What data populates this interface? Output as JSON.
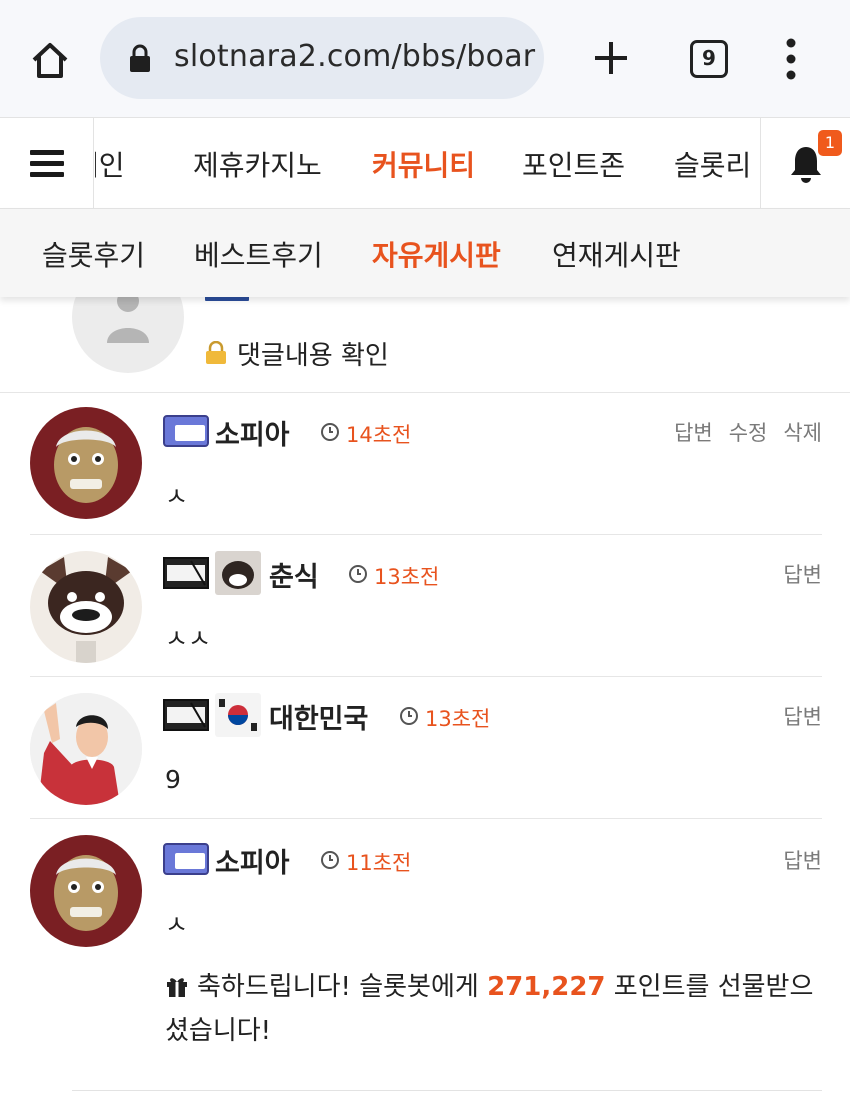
{
  "browser": {
    "url": "slotnara2.com/bbs/boar",
    "tab_count": "9",
    "icons": [
      "home-icon",
      "lock-icon",
      "plus-icon",
      "tabs-icon",
      "more-vert-icon"
    ]
  },
  "nav": {
    "items": [
      "메인",
      "제휴카지노",
      "커뮤니티",
      "포인트존",
      "슬롯리"
    ],
    "active": "커뮤니티",
    "notification_count": "1"
  },
  "subnav": {
    "items": [
      "슬롯후기",
      "베스트후기",
      "자유게시판",
      "연재게시판"
    ],
    "active": "자유게시판"
  },
  "first_comment": {
    "secret_text": "댓글내용 확인"
  },
  "comments": [
    {
      "author": "소피아",
      "time": "14초전",
      "actions": [
        "답변",
        "수정",
        "삭제"
      ],
      "text": "ㅅ"
    },
    {
      "author": "춘식",
      "time": "13초전",
      "actions": [
        "답변"
      ],
      "text": "ㅅㅅ"
    },
    {
      "author": "대한민국",
      "time": "13초전",
      "actions": [
        "답변"
      ],
      "text": "9"
    },
    {
      "author": "소피아",
      "time": "11초전",
      "actions": [
        "답변"
      ],
      "text": "ㅅ",
      "gift": {
        "prefix": "축하드립니다! 슬롯봇에게 ",
        "points": "271,227",
        "suffix": " 포인트를 선물받으셨습니다!"
      }
    }
  ],
  "colors": {
    "accent": "#e8531e",
    "badge": "#f05a1c",
    "urlbar": "#e5eaf2"
  }
}
